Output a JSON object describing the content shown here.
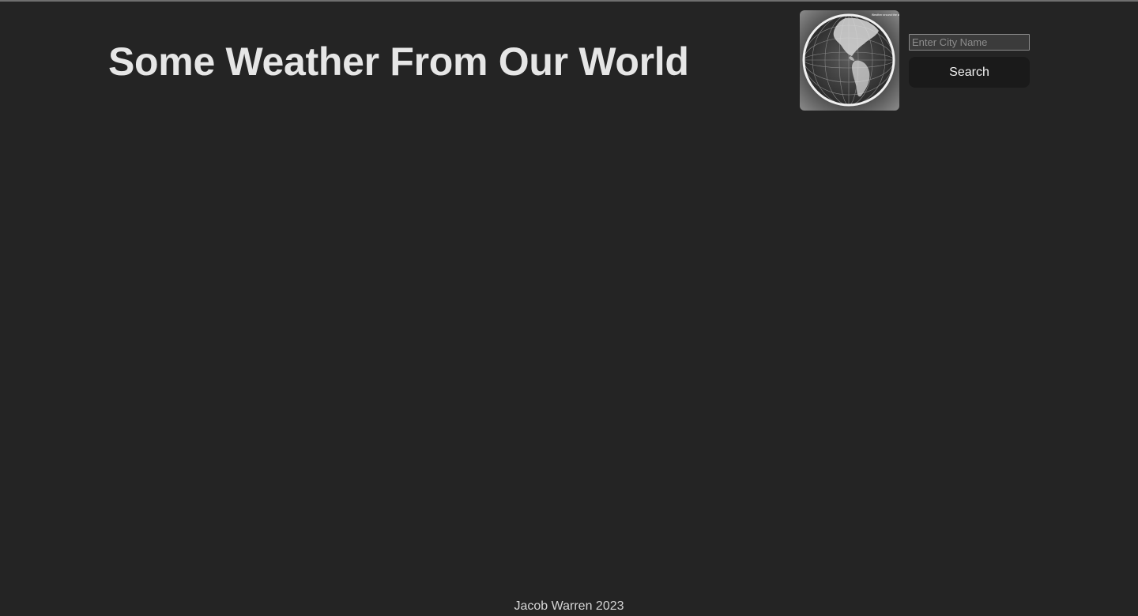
{
  "header": {
    "title": "Some Weather From Our World"
  },
  "search": {
    "placeholder": "Enter City Name",
    "value": "",
    "button_label": "Search"
  },
  "footer": {
    "text": "Jacob Warren 2023"
  },
  "colors": {
    "background": "#242424",
    "title_text": "#e6e6e6",
    "button_bg": "#1a1a1a"
  },
  "icons": {
    "logo": "globe-icon"
  }
}
